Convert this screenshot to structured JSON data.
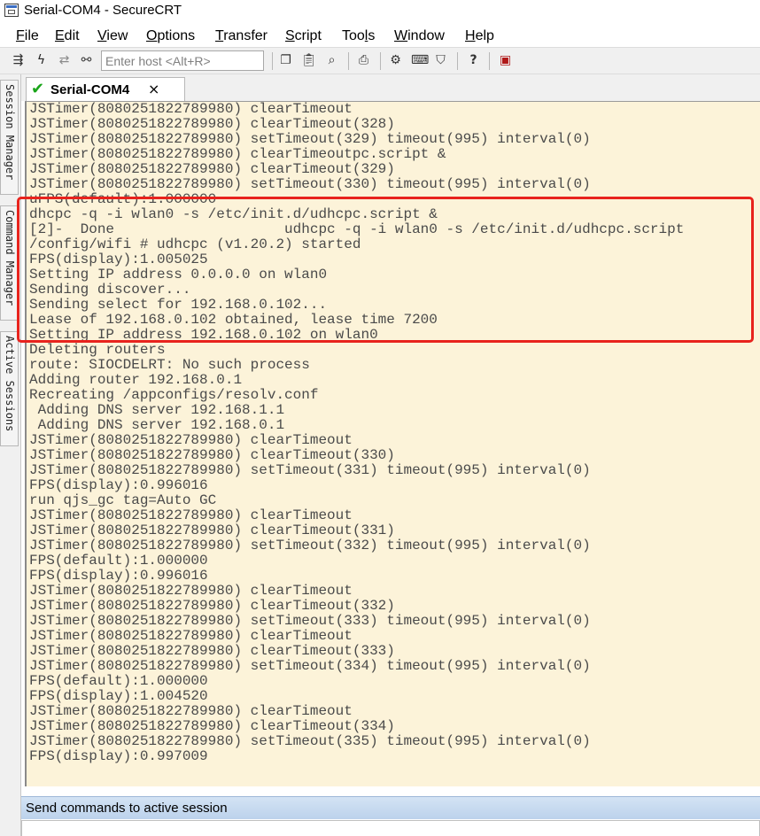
{
  "window": {
    "title": "Serial-COM4 - SecureCRT"
  },
  "menu": [
    {
      "mnemonic": "F",
      "rest": "ile"
    },
    {
      "mnemonic": "E",
      "rest": "dit"
    },
    {
      "mnemonic": "V",
      "rest": "iew"
    },
    {
      "mnemonic": "O",
      "rest": "ptions"
    },
    {
      "mnemonic": "T",
      "rest": "ransfer"
    },
    {
      "mnemonic": "S",
      "rest": "cript"
    },
    {
      "pre": "Too",
      "mnemonic": "l",
      "rest": "s"
    },
    {
      "mnemonic": "W",
      "rest": "indow"
    },
    {
      "mnemonic": "H",
      "rest": "elp"
    }
  ],
  "toolbar": {
    "host_placeholder": "Enter host <Alt+R>",
    "icons": [
      "connect-icon",
      "lightning-icon",
      "reconnect-icon",
      "disconnect-icon",
      "copy-icon",
      "paste-icon",
      "find-icon",
      "print-icon",
      "settings-icon",
      "keymap-icon",
      "sftp-icon",
      "help-icon",
      "keygen-icon"
    ]
  },
  "side_tabs": [
    "Session Manager",
    "Command Manager",
    "Active Sessions"
  ],
  "session_tab": {
    "label": "Serial-COM4",
    "status_icon": "check-icon",
    "close_glyph": "×"
  },
  "terminal": {
    "lines": [
      "JSTimer(8080251822789980) clearTimeout",
      "JSTimer(8080251822789980) clearTimeout(328)",
      "JSTimer(8080251822789980) setTimeout(329) timeout(995) interval(0)",
      "JSTimer(8080251822789980) clearTimeoutpc.script &",
      "JSTimer(8080251822789980) clearTimeout(329)",
      "JSTimer(8080251822789980) setTimeout(330) timeout(995) interval(0)",
      "uFPS(default):1.000000",
      "dhcpc -q -i wlan0 -s /etc/init.d/udhcpc.script &",
      "[2]-  Done                    udhcpc -q -i wlan0 -s /etc/init.d/udhcpc.script",
      "/config/wifi # udhcpc (v1.20.2) started",
      "FPS(display):1.005025",
      "Setting IP address 0.0.0.0 on wlan0",
      "Sending discover...",
      "Sending select for 192.168.0.102...",
      "Lease of 192.168.0.102 obtained, lease time 7200",
      "Setting IP address 192.168.0.102 on wlan0",
      "Deleting routers",
      "route: SIOCDELRT: No such process",
      "Adding router 192.168.0.1",
      "Recreating /appconfigs/resolv.conf",
      " Adding DNS server 192.168.1.1",
      " Adding DNS server 192.168.0.1",
      "JSTimer(8080251822789980) clearTimeout",
      "JSTimer(8080251822789980) clearTimeout(330)",
      "JSTimer(8080251822789980) setTimeout(331) timeout(995) interval(0)",
      "FPS(display):0.996016",
      "run qjs_gc tag=Auto GC",
      "JSTimer(8080251822789980) clearTimeout",
      "JSTimer(8080251822789980) clearTimeout(331)",
      "JSTimer(8080251822789980) setTimeout(332) timeout(995) interval(0)",
      "FPS(default):1.000000",
      "FPS(display):0.996016",
      "JSTimer(8080251822789980) clearTimeout",
      "JSTimer(8080251822789980) clearTimeout(332)",
      "JSTimer(8080251822789980) setTimeout(333) timeout(995) interval(0)",
      "JSTimer(8080251822789980) clearTimeout",
      "JSTimer(8080251822789980) clearTimeout(333)",
      "JSTimer(8080251822789980) setTimeout(334) timeout(995) interval(0)",
      "FPS(default):1.000000",
      "FPS(display):1.004520",
      "JSTimer(8080251822789980) clearTimeout",
      "JSTimer(8080251822789980) clearTimeout(334)",
      "JSTimer(8080251822789980) setTimeout(335) timeout(995) interval(0)",
      "FPS(display):0.997009"
    ],
    "background": "#fcf3d9",
    "text_color": "#4a4a4a",
    "highlight_color": "#e8231d"
  },
  "command_bar": {
    "label": "Send commands to active session"
  }
}
